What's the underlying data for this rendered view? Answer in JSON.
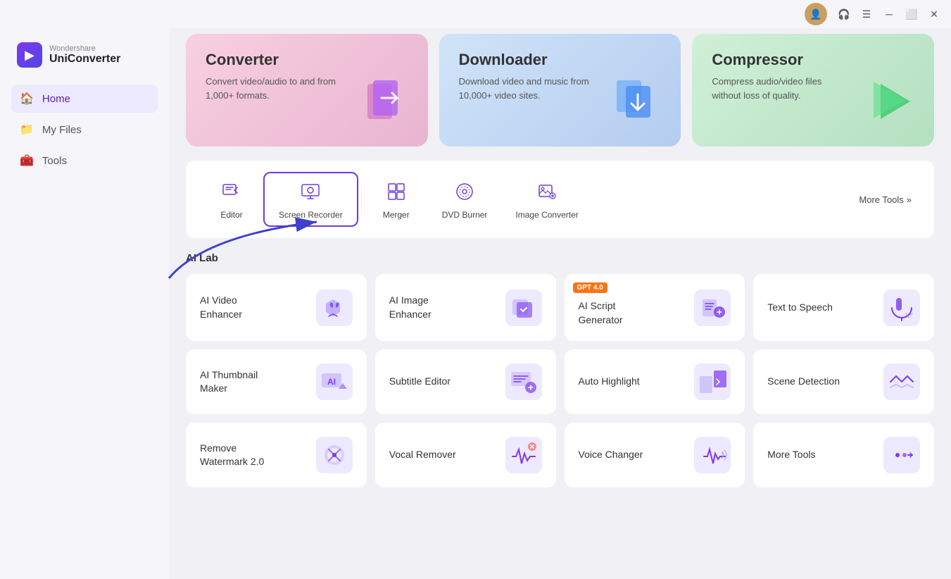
{
  "titlebar": {
    "window_controls": [
      "minimize",
      "maximize",
      "close"
    ]
  },
  "sidebar": {
    "brand": "Wondershare",
    "app_name": "UniConverter",
    "nav_items": [
      {
        "id": "home",
        "label": "Home",
        "icon": "🏠",
        "active": true
      },
      {
        "id": "myfiles",
        "label": "My Files",
        "icon": "📁",
        "active": false
      },
      {
        "id": "tools",
        "label": "Tools",
        "icon": "🧰",
        "active": false
      }
    ]
  },
  "hero_cards": [
    {
      "id": "converter",
      "title": "Converter",
      "desc": "Convert video/audio to and from 1,000+ formats.",
      "icon": "🔀",
      "type": "converter"
    },
    {
      "id": "downloader",
      "title": "Downloader",
      "desc": "Download video and music from 10,000+ video sites.",
      "icon": "📥",
      "type": "downloader"
    },
    {
      "id": "compressor",
      "title": "Compressor",
      "desc": "Compress audio/video files without loss of quality.",
      "icon": "▶️",
      "type": "compressor"
    }
  ],
  "tools": {
    "items": [
      {
        "id": "editor",
        "label": "Editor",
        "icon": "✂️",
        "active": false
      },
      {
        "id": "screen-recorder",
        "label": "Screen Recorder",
        "icon": "🖥️",
        "active": true
      },
      {
        "id": "merger",
        "label": "Merger",
        "icon": "⊞",
        "active": false
      },
      {
        "id": "dvd-burner",
        "label": "DVD Burner",
        "icon": "💿",
        "active": false
      },
      {
        "id": "image-converter",
        "label": "Image Converter",
        "icon": "🖼️",
        "active": false
      }
    ],
    "more_label": "More Tools"
  },
  "ai_lab": {
    "title": "AI Lab",
    "cards": [
      {
        "id": "ai-video-enhancer",
        "label": "AI Video\nEnhancer",
        "gpt": false
      },
      {
        "id": "ai-image-enhancer",
        "label": "AI Image\nEnhancer",
        "gpt": false
      },
      {
        "id": "ai-script-generator",
        "label": "AI Script\nGenerator",
        "gpt": true,
        "gpt_label": "GPT 4.0"
      },
      {
        "id": "text-to-speech",
        "label": "Text to Speech",
        "gpt": false
      },
      {
        "id": "ai-thumbnail-maker",
        "label": "AI Thumbnail\nMaker",
        "gpt": false
      },
      {
        "id": "subtitle-editor",
        "label": "Subtitle Editor",
        "gpt": false
      },
      {
        "id": "auto-highlight",
        "label": "Auto Highlight",
        "gpt": false
      },
      {
        "id": "scene-detection",
        "label": "Scene Detection",
        "gpt": false
      },
      {
        "id": "remove-watermark",
        "label": "Remove\nWatermark 2.0",
        "gpt": false
      },
      {
        "id": "vocal-remover",
        "label": "Vocal Remover",
        "gpt": false
      },
      {
        "id": "voice-changer",
        "label": "Voice Changer",
        "gpt": false
      },
      {
        "id": "more-tools",
        "label": "More Tools",
        "gpt": false,
        "isMore": true
      }
    ]
  }
}
